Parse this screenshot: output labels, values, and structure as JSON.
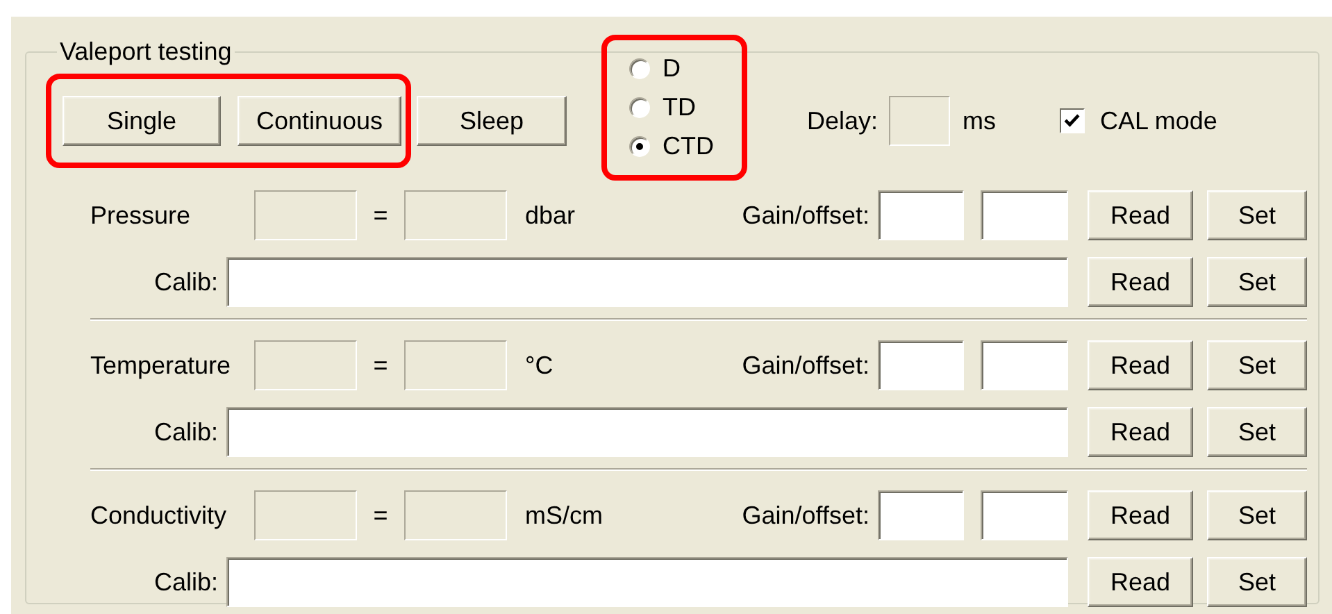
{
  "group_title": "Valeport testing",
  "buttons": [
    {
      "label": "Single",
      "highlighted": true
    },
    {
      "label": "Continuous",
      "highlighted": true
    },
    {
      "label": "Sleep",
      "highlighted": false
    }
  ],
  "mode": {
    "highlighted": true,
    "options": [
      {
        "label": "D",
        "selected": false
      },
      {
        "label": "TD",
        "selected": false
      },
      {
        "label": "CTD",
        "selected": true
      }
    ]
  },
  "delay": {
    "label": "Delay:",
    "unit": "ms"
  },
  "cal_mode": {
    "label": "CAL mode",
    "checked": true
  },
  "sensors": [
    {
      "name": "Pressure",
      "equals": "=",
      "unit": "dbar",
      "gain_label": "Gain/offset:",
      "buttons": [
        "Read",
        "Set"
      ],
      "calib_label": "Calib:",
      "calib_buttons": [
        "Read",
        "Set"
      ]
    },
    {
      "name": "Temperature",
      "equals": "=",
      "unit": "°C",
      "gain_label": "Gain/offset:",
      "buttons": [
        "Read",
        "Set"
      ],
      "calib_label": "Calib:",
      "calib_buttons": [
        "Read",
        "Set"
      ]
    },
    {
      "name": "Conductivity",
      "equals": "=",
      "unit": "mS/cm",
      "gain_label": "Gain/offset:",
      "buttons": [
        "Read",
        "Set"
      ],
      "calib_label": "Calib:",
      "calib_buttons": [
        "Read",
        "Set"
      ]
    }
  ]
}
